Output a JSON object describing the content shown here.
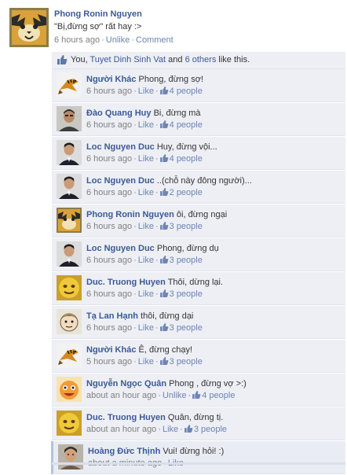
{
  "post": {
    "author": "Phong Ronin Nguyen",
    "text": "\"Bị,đừng sợ\" rất hay :>",
    "time": "6 hours ago",
    "unlike": "Unlike",
    "comment": "Comment"
  },
  "likes": {
    "you": "You,",
    "friend": "Tuyet Dinh Sinh Vat",
    "and": "and",
    "others": "6 others",
    "suffix": "like this."
  },
  "comments": [
    {
      "name": "Người Khác",
      "text": "Phong, đừng sợ!",
      "time": "6 hours ago",
      "action": "Like",
      "likes": "4 people",
      "avatar": "tiger-icon"
    },
    {
      "name": "Đào Quang Huy",
      "text": "Bi, đừng mà",
      "time": "6 hours ago",
      "action": "Like",
      "likes": "4 people",
      "avatar": "man-photo-icon"
    },
    {
      "name": "Loc Nguyen Duc",
      "text": "Huy, đừng vội...",
      "time": "6 hours ago",
      "action": "Like",
      "likes": "4 people",
      "avatar": "man-suit-icon"
    },
    {
      "name": "Loc Nguyen Duc",
      "text": "..(chỗ này đông người)...",
      "time": "6 hours ago",
      "action": "Like",
      "likes": "2 people",
      "avatar": "man-suit-icon"
    },
    {
      "name": "Phong Ronin Nguyen",
      "text": "ôi, đừng ngại",
      "time": "6 hours ago",
      "action": "Like",
      "likes": "3 people",
      "avatar": "tiger-mask-icon"
    },
    {
      "name": "Loc Nguyen Duc",
      "text": "Phong, đừng dụ",
      "time": "6 hours ago",
      "action": "Like",
      "likes": "3 people",
      "avatar": "man-suit-icon"
    },
    {
      "name": "Duc. Truong Huyen",
      "text": "Thôi, dừng lại.",
      "time": "6 hours ago",
      "action": "Like",
      "likes": "3 people",
      "avatar": "yellow-face-icon"
    },
    {
      "name": "Tạ Lan Hạnh",
      "text": "thôi, đừng dại",
      "time": "6 hours ago",
      "action": "Like",
      "likes": "3 people",
      "avatar": "cartoon-face-icon"
    },
    {
      "name": "Người Khác",
      "text": "Ê, đừng chạy!",
      "time": "5 hours ago",
      "action": "Like",
      "likes": "3 people",
      "avatar": "tiger-icon"
    },
    {
      "name": "Nguyễn Ngọc Quân",
      "text": "Phong , đừng vợ >:)",
      "time": "about an hour ago",
      "action": "Unlike",
      "likes": "4 people",
      "avatar": "orange-face-icon"
    },
    {
      "name": "Duc. Truong Huyen",
      "text": "Quân, đừng tị.",
      "time": "about an hour ago",
      "action": "Like",
      "likes": "3 people",
      "avatar": "yellow-face-icon"
    },
    {
      "name": "Hoàng Đức Thịnh",
      "text": "Vui! đừng hỏi! :)",
      "time": "about a minute ago",
      "action": "Like",
      "likes": "",
      "avatar": "person-photo-icon"
    }
  ],
  "colors": {
    "link": "#3b5998",
    "meta": "#808080",
    "comment_bg": "#edeff4"
  }
}
